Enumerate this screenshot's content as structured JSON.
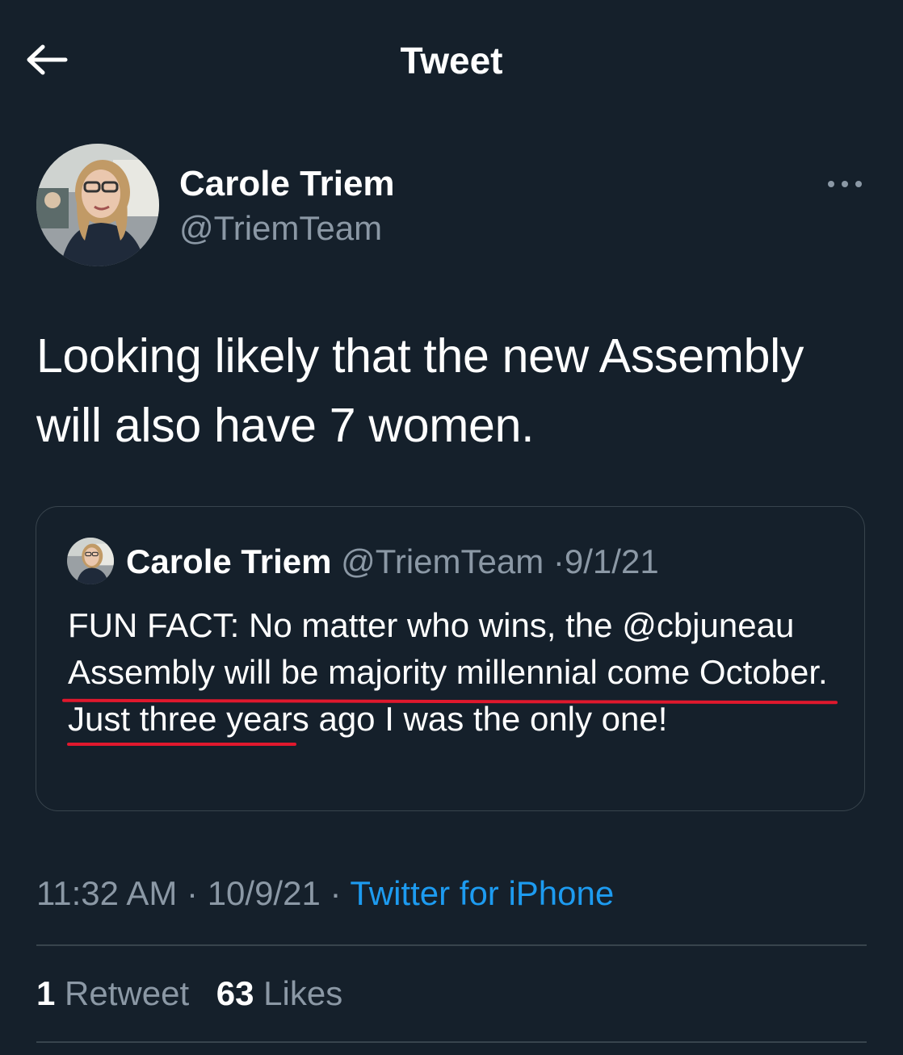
{
  "header": {
    "title": "Tweet",
    "back_icon": "arrow-left-icon"
  },
  "tweet": {
    "author_name": "Carole Triem",
    "author_handle": "@TriemTeam",
    "more_icon": "more-horizontal-icon",
    "text": "Looking likely that the new Assembly will also have 7 women.",
    "timestamp": "11:32 AM",
    "date": "10/9/21",
    "separator": "·",
    "source": "Twitter for iPhone"
  },
  "quoted_tweet": {
    "author_name": "Carole Triem",
    "author_handle": "@TriemTeam",
    "separator": "·",
    "date": "9/1/21",
    "text": "FUN FACT: No matter who wins, the @cbjuneau Assembly will be majority millennial come October. Just three years ago I was the only one!"
  },
  "stats": {
    "retweets_count": "1",
    "retweets_label": "Retweet",
    "likes_count": "63",
    "likes_label": "Likes"
  },
  "colors": {
    "background": "#15202b",
    "secondary_text": "#8b98a5",
    "link": "#1d9bf0",
    "border": "#38444d",
    "annotation_underline": "#e0182d"
  }
}
